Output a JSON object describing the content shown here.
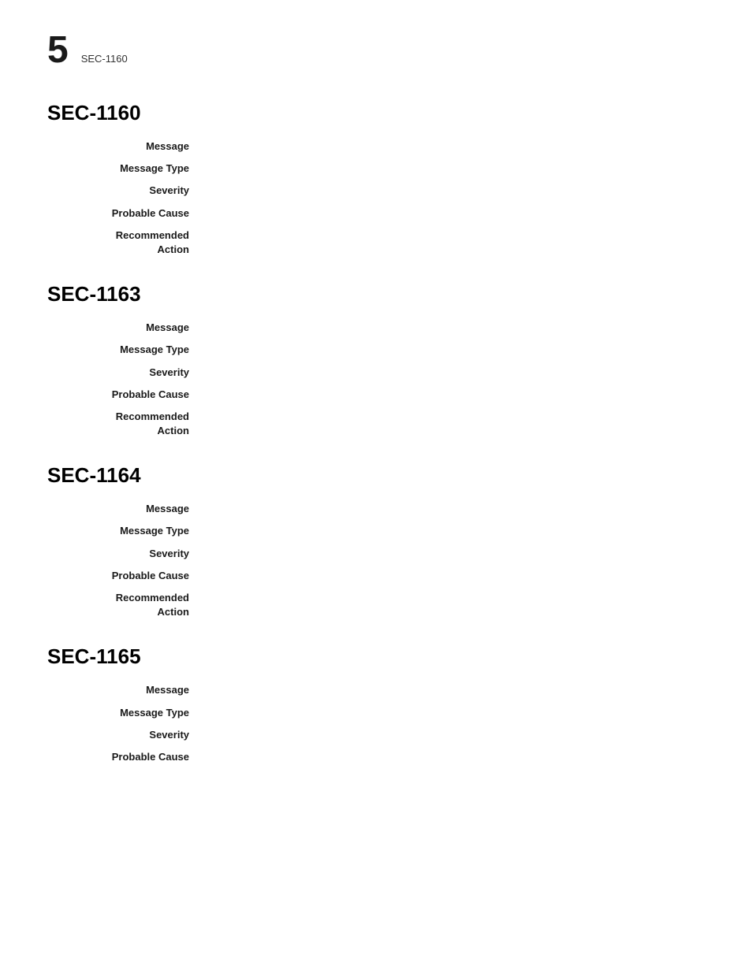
{
  "header": {
    "page_number": "5",
    "subtitle": "SEC-1160"
  },
  "sections": [
    {
      "id": "sec-1160",
      "title": "SEC-1160",
      "fields": [
        {
          "label": "Message",
          "value": ""
        },
        {
          "label": "Message Type",
          "value": ""
        },
        {
          "label": "Severity",
          "value": ""
        },
        {
          "label": "Probable Cause",
          "value": ""
        },
        {
          "label": "Recommended\nAction",
          "value": ""
        }
      ]
    },
    {
      "id": "sec-1163",
      "title": "SEC-1163",
      "fields": [
        {
          "label": "Message",
          "value": ""
        },
        {
          "label": "Message Type",
          "value": ""
        },
        {
          "label": "Severity",
          "value": ""
        },
        {
          "label": "Probable Cause",
          "value": ""
        },
        {
          "label": "Recommended\nAction",
          "value": ""
        }
      ]
    },
    {
      "id": "sec-1164",
      "title": "SEC-1164",
      "fields": [
        {
          "label": "Message",
          "value": ""
        },
        {
          "label": "Message Type",
          "value": ""
        },
        {
          "label": "Severity",
          "value": ""
        },
        {
          "label": "Probable Cause",
          "value": ""
        },
        {
          "label": "Recommended\nAction",
          "value": ""
        }
      ]
    },
    {
      "id": "sec-1165",
      "title": "SEC-1165",
      "fields": [
        {
          "label": "Message",
          "value": ""
        },
        {
          "label": "Message Type",
          "value": ""
        },
        {
          "label": "Severity",
          "value": ""
        },
        {
          "label": "Probable Cause",
          "value": ""
        }
      ]
    }
  ]
}
